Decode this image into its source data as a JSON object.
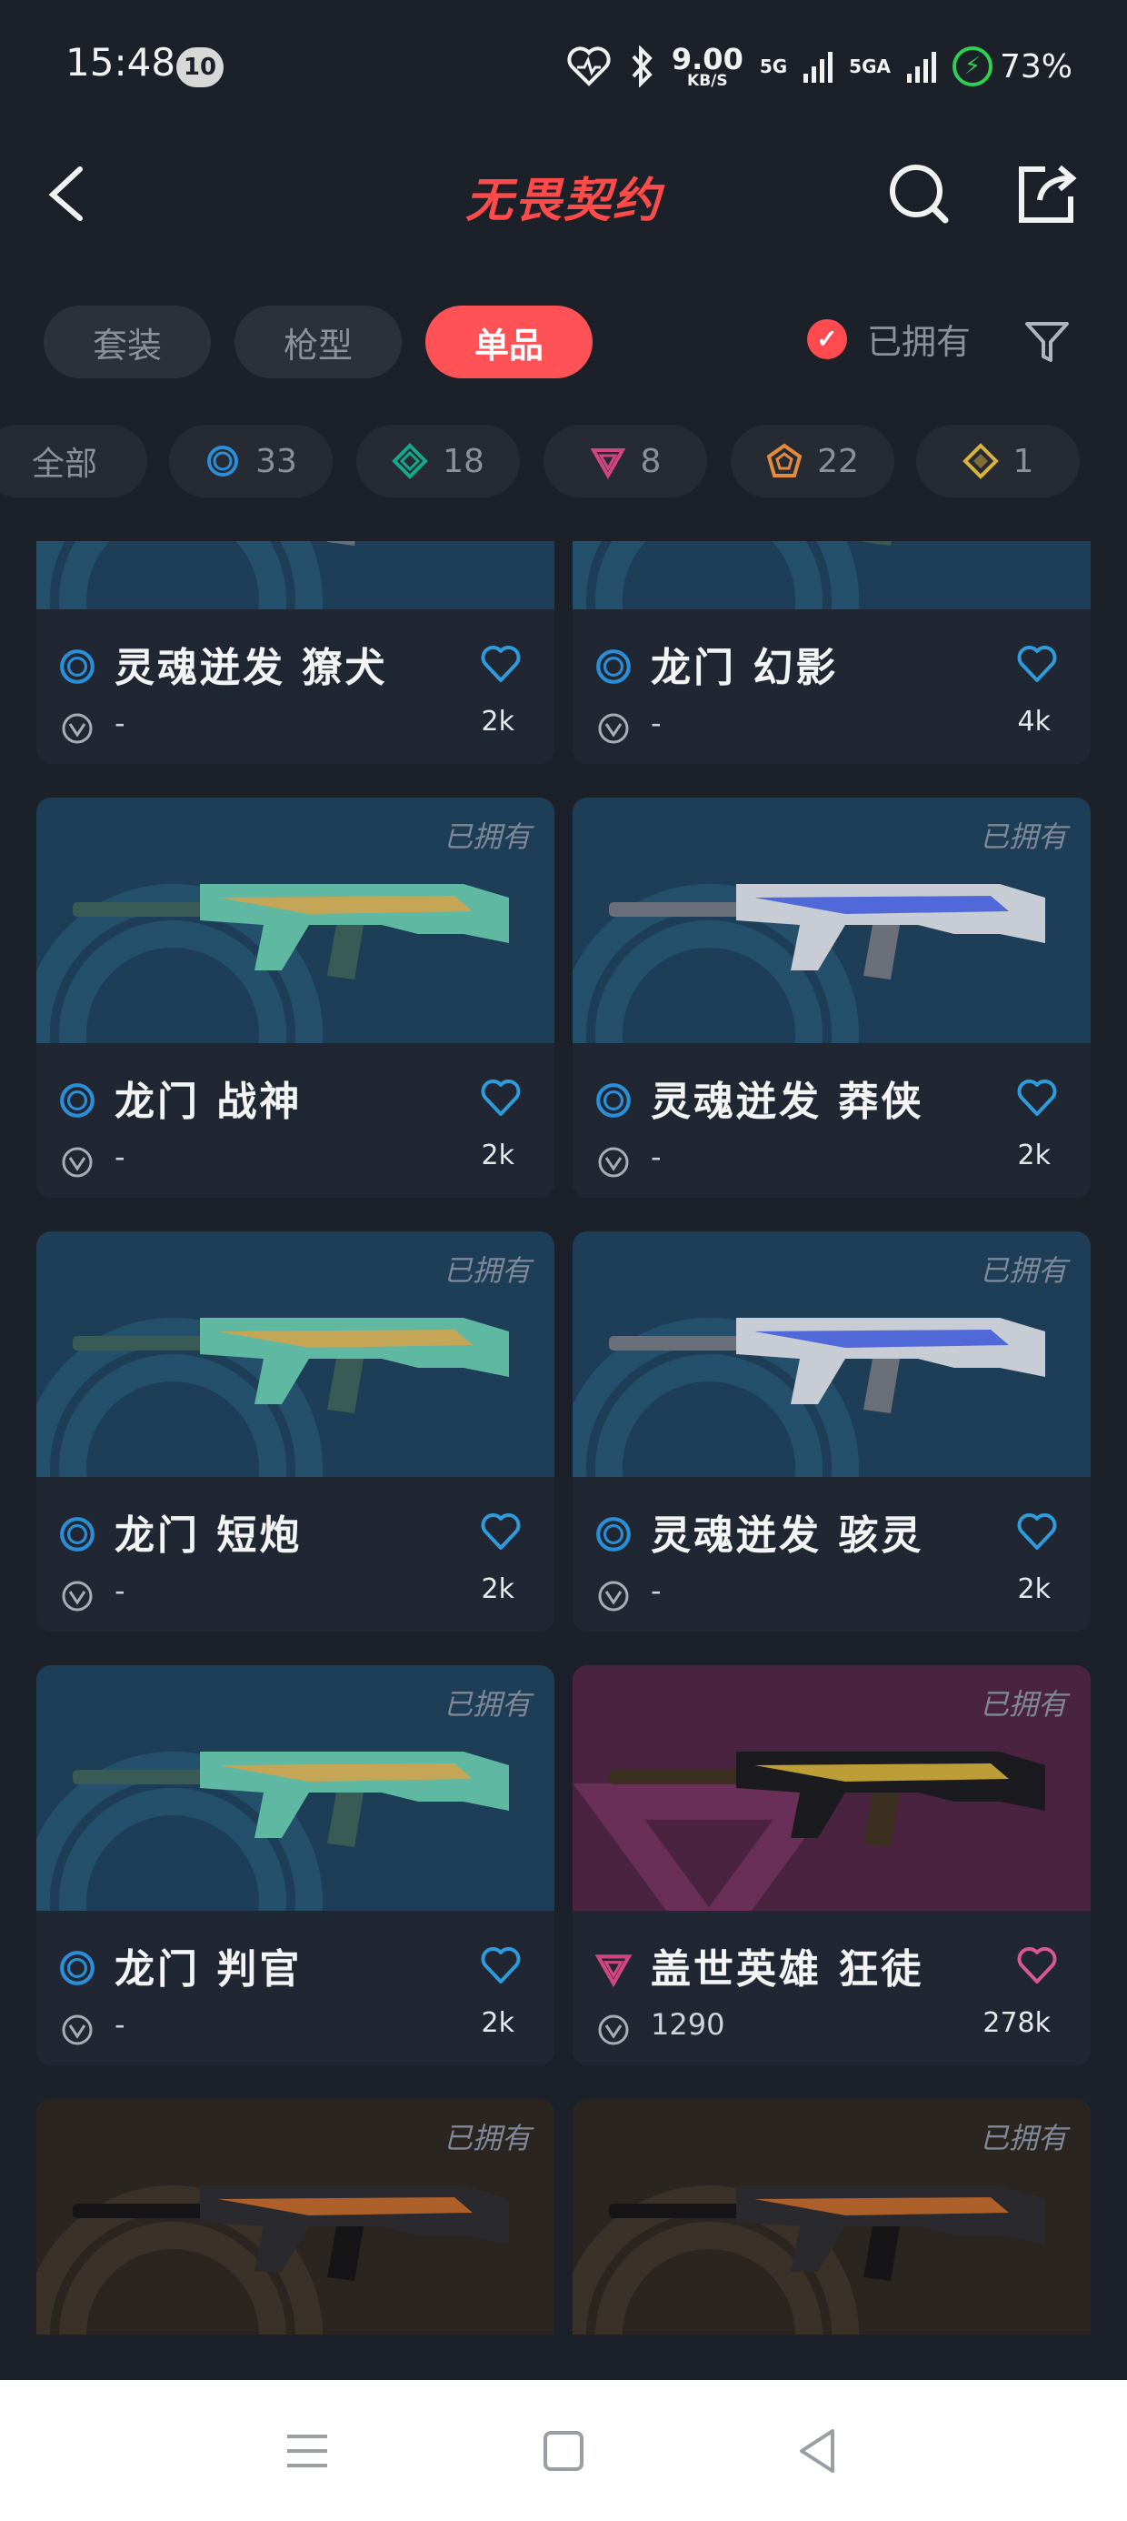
{
  "status_bar": {
    "time": "15:48",
    "notification_count": "10",
    "net_speed": "9.00",
    "net_unit": "KB/S",
    "sim1": "5G",
    "sim2": "5GA",
    "battery": "73%"
  },
  "header": {
    "title": "无畏契约"
  },
  "tabs": [
    {
      "label": "套装",
      "active": false
    },
    {
      "label": "枪型",
      "active": false
    },
    {
      "label": "单品",
      "active": true
    }
  ],
  "owned_filter": {
    "label": "已拥有",
    "checked": true
  },
  "rarity_filters": [
    {
      "label": "全部",
      "icon": "all"
    },
    {
      "label": "33",
      "icon": "select-tier-icon",
      "color": "#2b8fd8"
    },
    {
      "label": "18",
      "icon": "deluxe-tier-icon",
      "color": "#15a98b"
    },
    {
      "label": "8",
      "icon": "premium-tier-icon",
      "color": "#d0467e"
    },
    {
      "label": "22",
      "icon": "exclusive-tier-icon",
      "color": "#e38a3c"
    },
    {
      "label": "1",
      "icon": "ultra-tier-icon",
      "color": "#d9b43a"
    }
  ],
  "cards": [
    {
      "name": "灵魂迸发 獠犬",
      "price": "-",
      "likes": "2k",
      "owned_label": "",
      "tier": "select",
      "theme": "blue-silver",
      "bg": "blue"
    },
    {
      "name": "龙门 幻影",
      "price": "-",
      "likes": "4k",
      "owned_label": "",
      "tier": "select",
      "theme": "jade",
      "bg": "blue"
    },
    {
      "name": "龙门 战神",
      "price": "-",
      "likes": "2k",
      "owned_label": "已拥有",
      "tier": "select",
      "theme": "jade",
      "bg": "blue"
    },
    {
      "name": "灵魂迸发 莽侠",
      "price": "-",
      "likes": "2k",
      "owned_label": "已拥有",
      "tier": "select",
      "theme": "blue-silver",
      "bg": "blue"
    },
    {
      "name": "龙门 短炮",
      "price": "-",
      "likes": "2k",
      "owned_label": "已拥有",
      "tier": "select",
      "theme": "jade",
      "bg": "blue"
    },
    {
      "name": "灵魂迸发 骇灵",
      "price": "-",
      "likes": "2k",
      "owned_label": "已拥有",
      "tier": "select",
      "theme": "blue-silver",
      "bg": "blue"
    },
    {
      "name": "龙门 判官",
      "price": "-",
      "likes": "2k",
      "owned_label": "已拥有",
      "tier": "select",
      "theme": "jade",
      "bg": "blue"
    },
    {
      "name": "盖世英雄 狂徒",
      "price": "1290",
      "likes": "278k",
      "owned_label": "已拥有",
      "tier": "premium",
      "theme": "gold-black",
      "bg": "pink"
    },
    {
      "name": "",
      "price": "",
      "likes": "",
      "owned_label": "已拥有",
      "tier": "",
      "theme": "dark",
      "bg": "dark"
    },
    {
      "name": "",
      "price": "",
      "likes": "",
      "owned_label": "已拥有",
      "tier": "",
      "theme": "dark",
      "bg": "dark"
    }
  ],
  "colors": {
    "accent": "#ff5257",
    "select_tier": "#2b8fd8",
    "premium_tier": "#d0467e",
    "heart_blue": "#2e9cdb",
    "heart_pink": "#d6598f"
  }
}
